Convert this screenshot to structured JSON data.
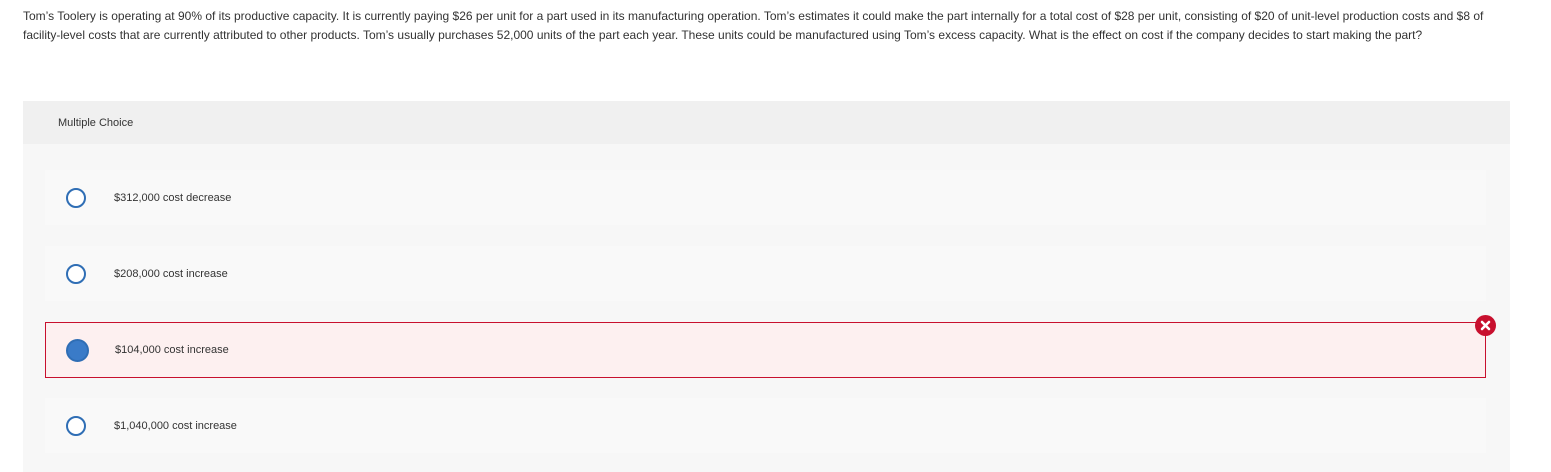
{
  "question": {
    "text": "Tom’s Toolery is operating at 90% of its productive capacity. It is currently paying $26 per unit for a part used in its manufacturing operation. Tom’s estimates it could make the part internally for a total cost of $28 per unit, consisting of $20 of unit-level production costs and $8 of facility-level costs that are currently attributed to other products. Tom’s usually purchases 52,000 units of the part each year. These units could be manufactured using Tom’s excess capacity. What is the effect on cost if the company decides to start making the part?"
  },
  "panel": {
    "header": "Multiple Choice"
  },
  "choices": [
    {
      "label": "$312,000 cost decrease",
      "selected": false
    },
    {
      "label": "$208,000 cost increase",
      "selected": false
    },
    {
      "label": "$104,000 cost increase",
      "selected": true,
      "status": "incorrect"
    },
    {
      "label": "$1,040,000 cost increase",
      "selected": false
    }
  ],
  "colors": {
    "radio_border": "#2f6eb5",
    "radio_fill": "#3a7bc8",
    "incorrect": "#c8102e",
    "incorrect_bg": "#fdf0f0"
  },
  "icons": {
    "incorrect": "close-x-icon"
  }
}
